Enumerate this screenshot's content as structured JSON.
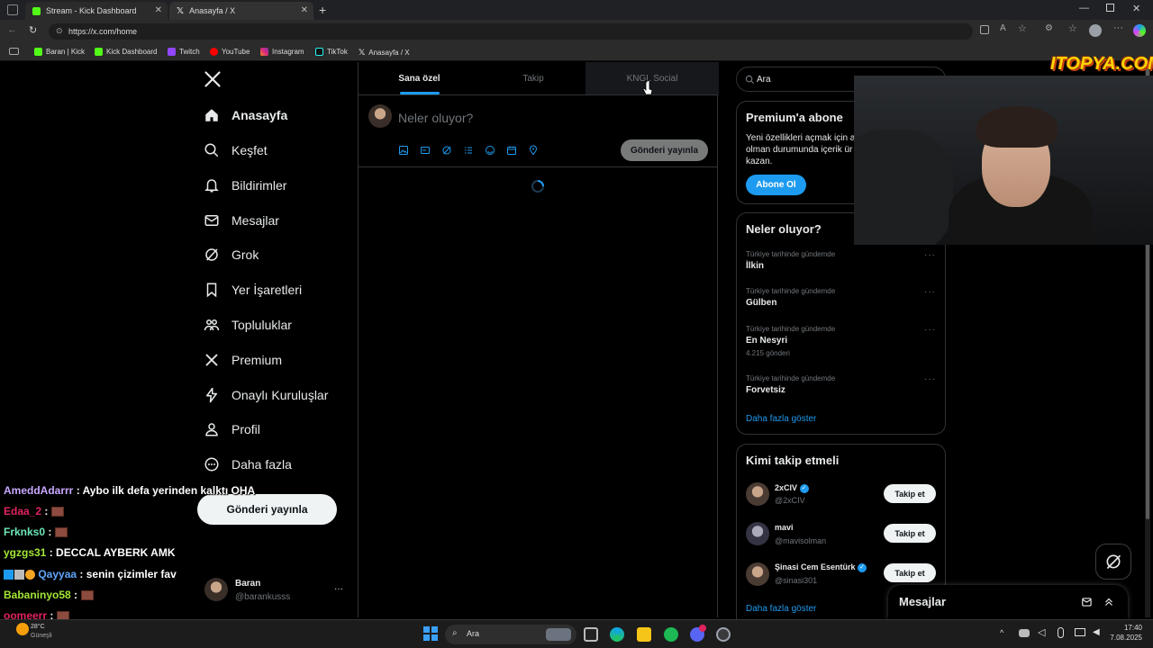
{
  "browser": {
    "tabs": [
      {
        "title": "Stream - Kick Dashboard",
        "active": false
      },
      {
        "title": "Anasayfa / X",
        "active": true
      }
    ],
    "url": "https://x.com/home",
    "bookmarks": [
      {
        "label": "Baran | Kick",
        "icon": "kick-icon"
      },
      {
        "label": "Kick Dashboard",
        "icon": "kick-icon"
      },
      {
        "label": "Twitch",
        "icon": "twitch-icon"
      },
      {
        "label": "YouTube",
        "icon": "youtube-icon"
      },
      {
        "label": "Instagram",
        "icon": "instagram-icon"
      },
      {
        "label": "TikTok",
        "icon": "tiktok-icon"
      },
      {
        "label": "Anasayfa / X",
        "icon": "x-icon"
      }
    ]
  },
  "sidebar": {
    "items": [
      {
        "label": "Anasayfa",
        "icon": "home-icon",
        "active": true
      },
      {
        "label": "Keşfet",
        "icon": "search-icon"
      },
      {
        "label": "Bildirimler",
        "icon": "bell-icon"
      },
      {
        "label": "Mesajlar",
        "icon": "mail-icon"
      },
      {
        "label": "Grok",
        "icon": "grok-icon"
      },
      {
        "label": "Yer İşaretleri",
        "icon": "bookmark-icon"
      },
      {
        "label": "Topluluklar",
        "icon": "communities-icon"
      },
      {
        "label": "Premium",
        "icon": "x-logo-icon"
      },
      {
        "label": "Onaylı Kuruluşlar",
        "icon": "lightning-icon"
      },
      {
        "label": "Profil",
        "icon": "person-icon"
      },
      {
        "label": "Daha fazla",
        "icon": "more-circle-icon"
      }
    ],
    "post_button": "Gönderi yayınla",
    "account": {
      "name": "Baran",
      "handle": "@barankusss"
    }
  },
  "main": {
    "tabs": [
      {
        "label": "Sana özel",
        "active": true
      },
      {
        "label": "Takip",
        "active": false
      },
      {
        "label": "KNGL Social",
        "active": false
      }
    ],
    "compose": {
      "placeholder": "Neler oluyor?",
      "submit": "Gönderi yayınla"
    }
  },
  "right": {
    "search_placeholder": "Ara",
    "premium": {
      "title": "Premium'a abone",
      "lines": [
        "Yeni özellikleri açmak için al",
        "olman durumunda içerik ür",
        "kazan."
      ],
      "button": "Abone Ol"
    },
    "trends": {
      "title": "Neler oluyor?",
      "items": [
        {
          "context": "Türkiye tarihinde gündemde",
          "name": "İlkin",
          "count": ""
        },
        {
          "context": "Türkiye tarihinde gündemde",
          "name": "Gülben",
          "count": ""
        },
        {
          "context": "Türkiye tarihinde gündemde",
          "name": "En Nesyri",
          "count": "4.215 gönderi"
        },
        {
          "context": "Türkiye tarihinde gündemde",
          "name": "Forvetsiz",
          "count": ""
        }
      ],
      "more": "Daha fazla göster"
    },
    "who_to_follow": {
      "title": "Kimi takip etmeli",
      "users": [
        {
          "name": "2xCIV",
          "handle": "@2xCIV",
          "verified": true
        },
        {
          "name": "mavi",
          "handle": "@mavisolman",
          "verified": false
        },
        {
          "name": "Şinasi Cem Esentürk",
          "handle": "@sinasi301",
          "verified": true
        }
      ],
      "follow_label": "Takip et",
      "more": "Daha fazla göster"
    },
    "messages_label": "Mesajlar"
  },
  "overlay": {
    "watermark": "ITOPYA.COM",
    "chat": [
      {
        "user": "AmeddAdarrr",
        "msg": ": Aybo ilk defa yerinden kalktı OHA",
        "color": "#c9a7ff",
        "emote": false
      },
      {
        "user": "Edaa_2",
        "msg": ":",
        "color": "#e0245e",
        "emote": true
      },
      {
        "user": "Frknks0",
        "msg": ":",
        "color": "#6ee7b7",
        "emote": true
      },
      {
        "user": "ygzgs31",
        "msg": ": DECCAL AYBERK AMK",
        "color": "#a3e635",
        "emote": false
      },
      {
        "user": "Qayyaa",
        "msg": ": senin çizimler fav",
        "color": "#60a5fa",
        "emote": false
      },
      {
        "user": "Babaninyo58",
        "msg": ":",
        "color": "#a3e635",
        "emote": true
      },
      {
        "user": "oomeerr",
        "msg": ":",
        "color": "#e0245e",
        "emote": true
      },
      {
        "user": "Edaa_2",
        "msg": "",
        "color": "#e0245e",
        "emote": true
      }
    ]
  },
  "taskbar": {
    "weather": "28°C",
    "weather_sub": "Güneşli",
    "search": "Ara",
    "time": "17:40",
    "date": "7.08.2025"
  },
  "colors": {
    "accent": "#1d9bf0",
    "kick": "#53fc18",
    "background": "#000000"
  }
}
